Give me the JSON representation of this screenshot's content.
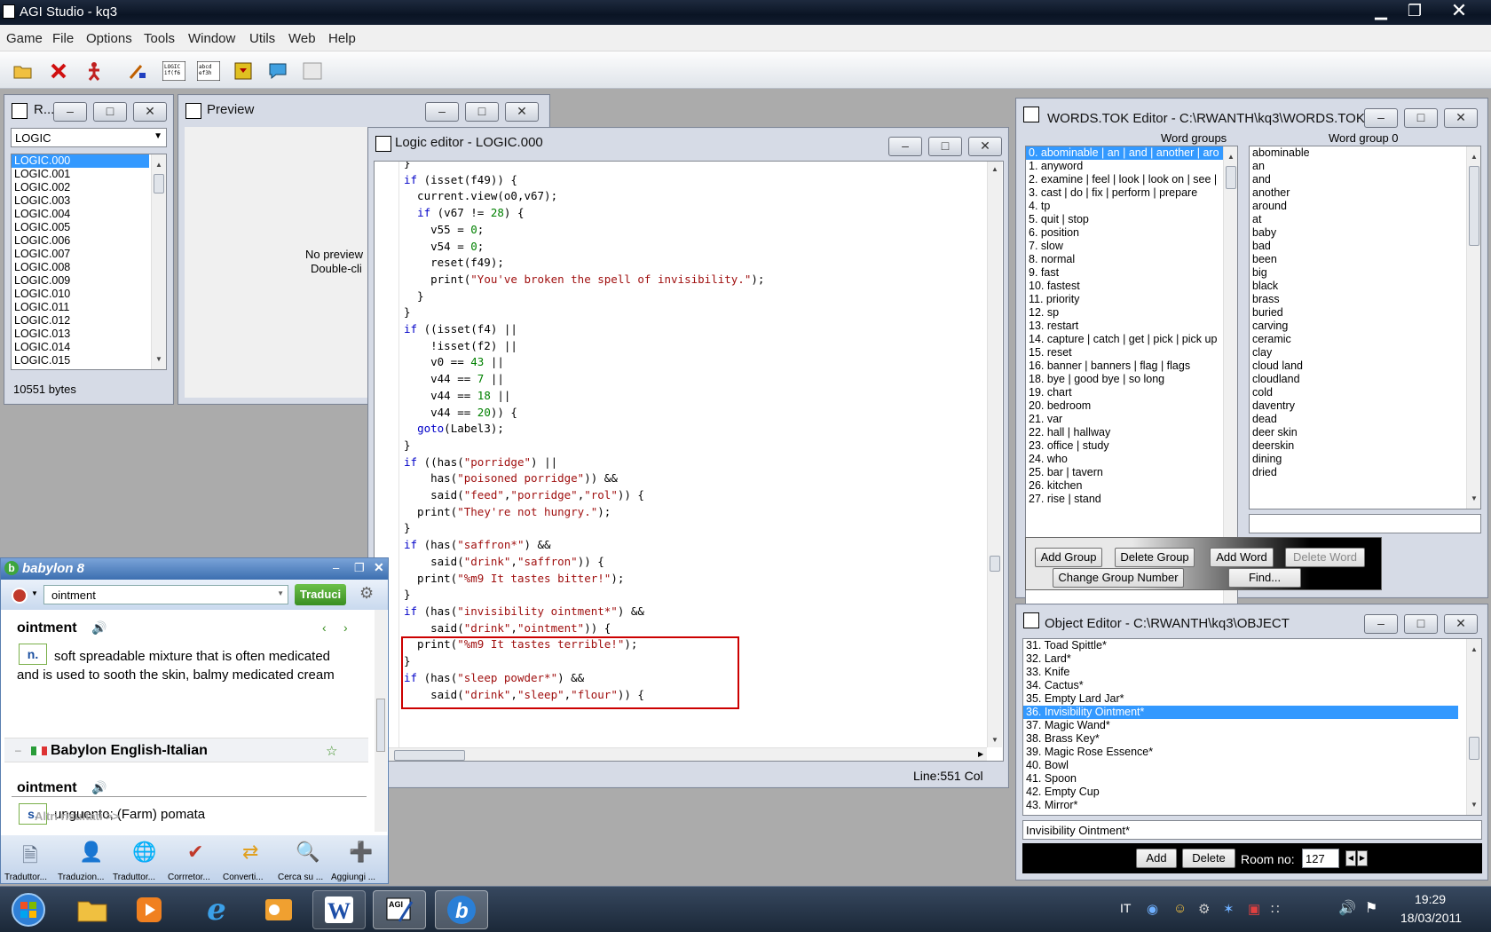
{
  "app": {
    "title": "AGI Studio - kq3"
  },
  "menu": [
    "Game",
    "File",
    "Options",
    "Tools",
    "Window",
    "Utils",
    "Web",
    "Help"
  ],
  "resource_window": {
    "title": "R...",
    "type_selected": "LOGIC",
    "items": [
      "LOGIC.000",
      "LOGIC.001",
      "LOGIC.002",
      "LOGIC.003",
      "LOGIC.004",
      "LOGIC.005",
      "LOGIC.006",
      "LOGIC.007",
      "LOGIC.008",
      "LOGIC.009",
      "LOGIC.010",
      "LOGIC.011",
      "LOGIC.012",
      "LOGIC.013",
      "LOGIC.014",
      "LOGIC.015"
    ],
    "status": "10551 bytes"
  },
  "preview_window": {
    "title": "Preview",
    "line1": "No preview",
    "line2": "Double-cli"
  },
  "logic_editor": {
    "title": "Logic editor - LOGIC.000",
    "status": "Line:551 Col"
  },
  "words_editor": {
    "title": "WORDS.TOK Editor - C:\\RWANTH\\kq3\\WORDS.TOK",
    "groups_header": "Word groups",
    "words_header": "Word group 0",
    "groups": [
      "0. abominable | an | and | another | aro",
      "1. anyword",
      "2. examine | feel | look | look on | see |",
      "3. cast | do | fix | perform | prepare",
      "4. tp",
      "5. quit | stop",
      "6. position",
      "7. slow",
      "8. normal",
      "9. fast",
      "10. fastest",
      "11. priority",
      "12. sp",
      "13. restart",
      "14. capture | catch | get | pick | pick up",
      "15. reset",
      "16. banner | banners | flag | flags",
      "18. bye | good bye | so long",
      "19. chart",
      "20. bedroom",
      "21. var",
      "22. hall | hallway",
      "23. office | study",
      "24. who",
      "25. bar | tavern",
      "26. kitchen",
      "27. rise | stand"
    ],
    "words": [
      "abominable",
      "an",
      "and",
      "another",
      "around",
      "at",
      "baby",
      "bad",
      "been",
      "big",
      "black",
      "brass",
      "buried",
      "carving",
      "ceramic",
      "clay",
      "cloud land",
      "cloudland",
      "cold",
      "daventry",
      "dead",
      "deer skin",
      "deerskin",
      "dining",
      "dried"
    ],
    "buttons": {
      "add_group": "Add Group",
      "delete_group": "Delete Group",
      "add_word": "Add Word",
      "delete_word": "Delete Word",
      "change_group": "Change Group Number",
      "find": "Find..."
    }
  },
  "object_editor": {
    "title": "Object Editor - C:\\RWANTH\\kq3\\OBJECT",
    "items": [
      "31. Toad Spittle*",
      "32. Lard*",
      "33. Knife",
      "34. Cactus*",
      "35. Empty Lard Jar*",
      "36. Invisibility Ointment*",
      "37. Magic Wand*",
      "38. Brass Key*",
      "39. Magic Rose Essence*",
      "40. Bowl",
      "41. Spoon",
      "42. Empty Cup",
      "43. Mirror*"
    ],
    "selected_index": 5,
    "name_value": "Invisibility Ointment*",
    "add_label": "Add",
    "delete_label": "Delete",
    "room_label": "Room no:",
    "room_value": "127"
  },
  "babylon": {
    "title": "babylon 8",
    "search_value": "ointment",
    "translate_button": "Traduci",
    "headword1": "ointment",
    "pos1": "n.",
    "definition1": "soft spreadable mixture that is often medicated and is used to sooth the skin, balmy medicated cream",
    "dictionary": "Babylon English-Italian",
    "headword2": "ointment",
    "pos2": "s.",
    "definition2": "unguento; (Farm) pomata",
    "more_results": "Altri risultati >>",
    "tools": [
      "Traduttor...",
      "Traduzion...",
      "Traduttor...",
      "Corrretor...",
      "Converti...",
      "Cerca su ...",
      "Aggiungi ..."
    ]
  },
  "taskbar": {
    "lang": "IT",
    "time": "19:29",
    "date": "18/03/2011"
  },
  "colors": {
    "selection": "#3399ff",
    "highlight_box": "#cc0000",
    "keyword": "#0000c8",
    "number": "#008000",
    "string": "#a01010"
  }
}
